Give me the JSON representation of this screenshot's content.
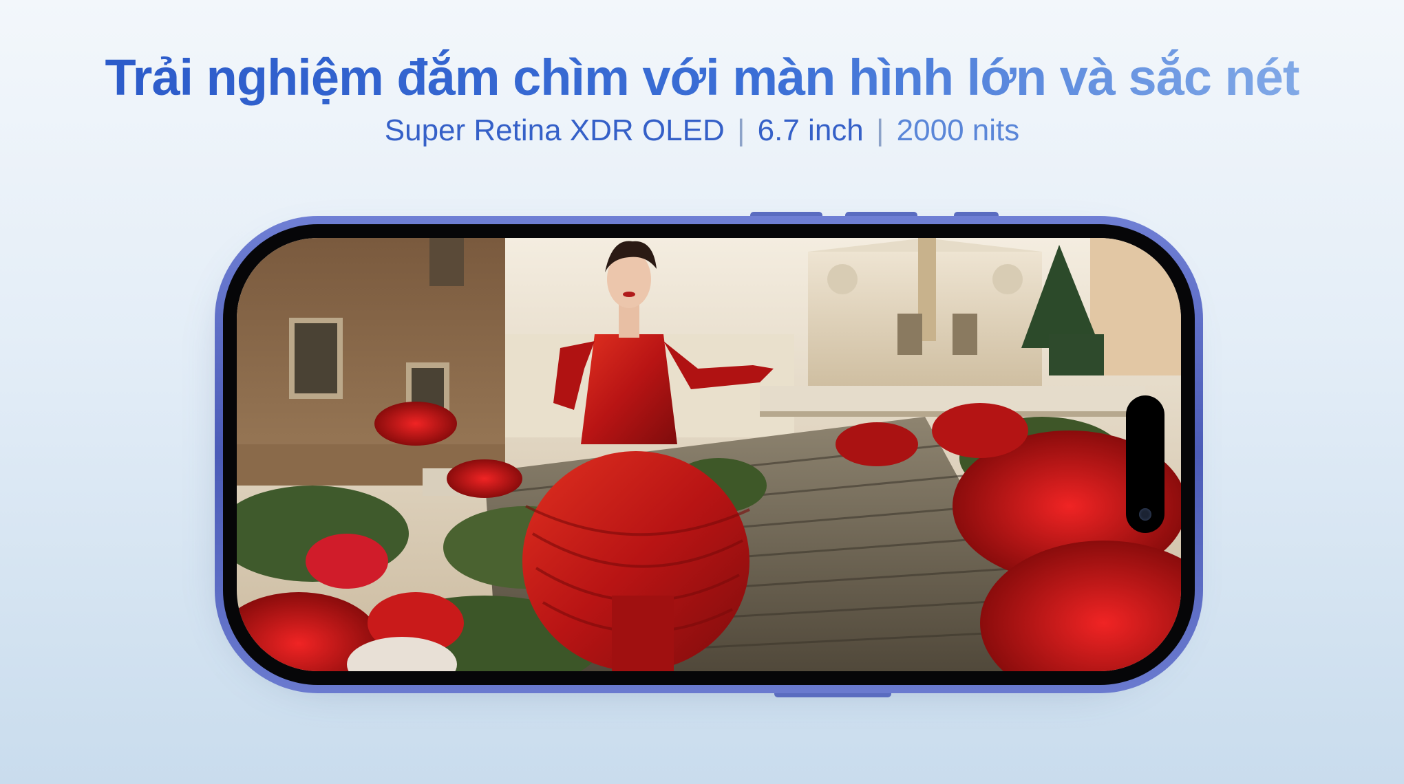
{
  "headline": "Trải nghiệm đắm chìm với màn hình lớn và sắc nét",
  "specs": {
    "display": "Super Retina XDR OLED",
    "size": "6.7 inch",
    "brightness": "2000 nits",
    "separator": "|"
  },
  "icons": {
    "device": "phone-landscape-icon",
    "island": "dynamic-island-icon",
    "camera": "front-camera-icon"
  },
  "colors": {
    "headline": "#2a58c8",
    "frame": "#5566c4",
    "dress": "#c41818",
    "flowers": "#d42020"
  }
}
